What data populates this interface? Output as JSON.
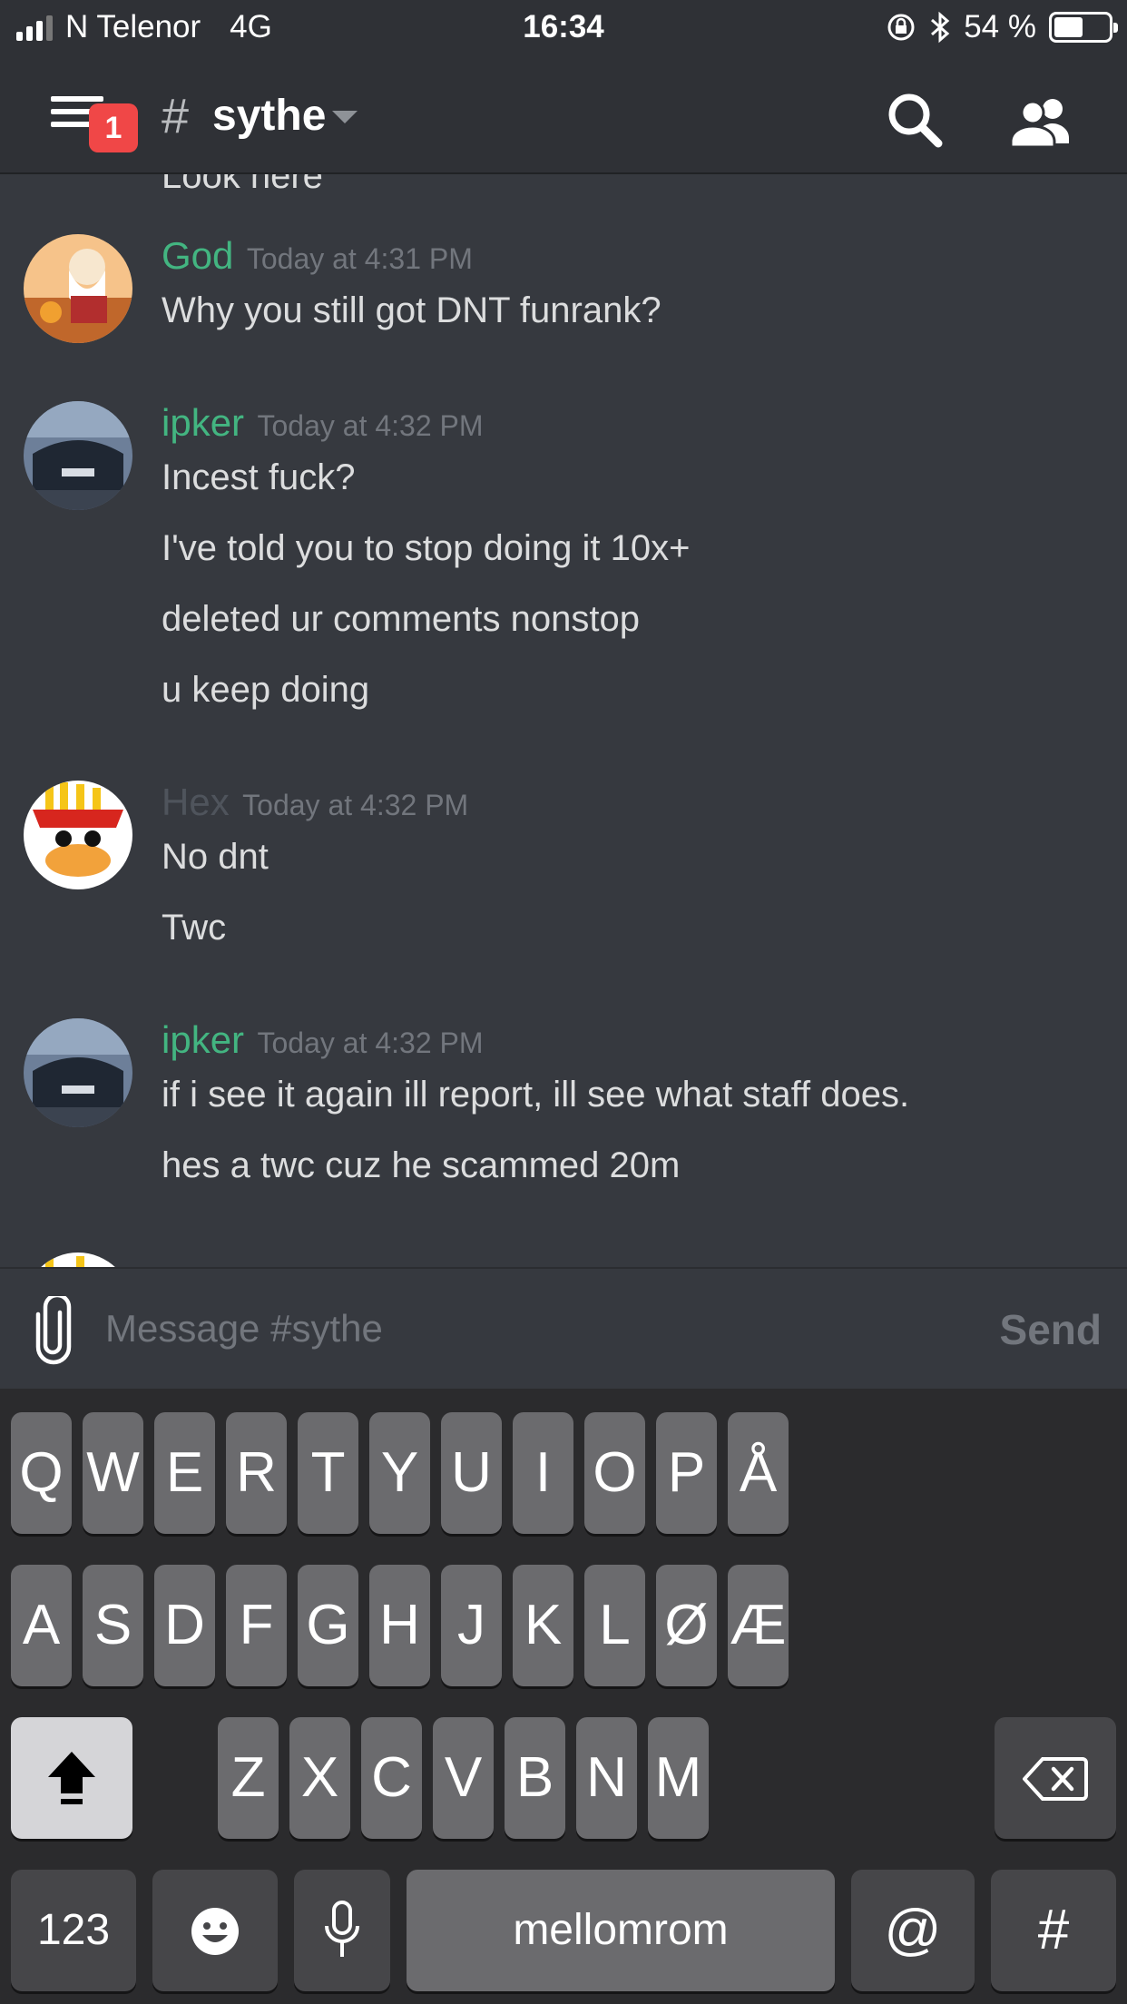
{
  "status_bar": {
    "carrier": "N Telenor",
    "network": "4G",
    "time": "16:34",
    "battery": "54 %",
    "battery_level": 0.54
  },
  "header": {
    "notification_count": "1",
    "channel_hash": "#",
    "channel_name": "sythe"
  },
  "messages": {
    "partial_previous": "Look here",
    "groups": [
      {
        "author": "God",
        "author_color": "#43b581",
        "timestamp": "Today at 4:31 PM",
        "lines": [
          "Why you still got DNT funrank?"
        ]
      },
      {
        "author": "ipker",
        "author_color": "#43b581",
        "timestamp": "Today at 4:32 PM",
        "lines": [
          "Incest fuck?",
          "I've told you to stop doing it 10x+",
          "deleted ur comments nonstop",
          "u keep doing"
        ]
      },
      {
        "author": "Hex",
        "author_color": "#4f545c",
        "timestamp": "Today at 4:32 PM",
        "lines": [
          "No dnt",
          "Twc"
        ]
      },
      {
        "author": "ipker",
        "author_color": "#43b581",
        "timestamp": "Today at 4:32 PM",
        "lines": [
          "if i see it again ill report, ill see what staff does.",
          "hes a twc cuz he scammed 20m"
        ]
      }
    ]
  },
  "composer": {
    "placeholder": "Message #sythe",
    "send_label": "Send"
  },
  "keyboard": {
    "row1": [
      "Q",
      "W",
      "E",
      "R",
      "T",
      "Y",
      "U",
      "I",
      "O",
      "P",
      "Å"
    ],
    "row2": [
      "A",
      "S",
      "D",
      "F",
      "G",
      "H",
      "J",
      "K",
      "L",
      "Ø",
      "Æ"
    ],
    "row3": [
      "Z",
      "X",
      "C",
      "V",
      "B",
      "N",
      "M"
    ],
    "numbers_label": "123",
    "space_label": "mellomrom",
    "at_label": "@",
    "hash_label": "#"
  }
}
